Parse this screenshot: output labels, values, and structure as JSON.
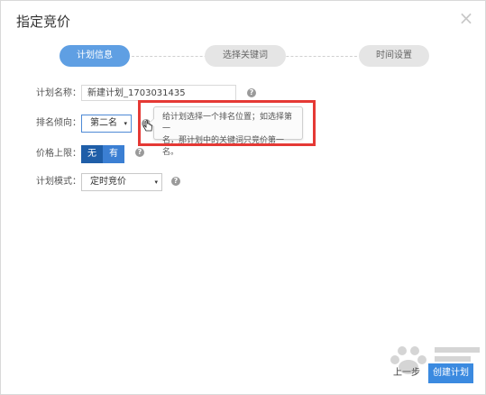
{
  "dialog": {
    "title": "指定竞价",
    "close_icon": "close-icon"
  },
  "steps": [
    {
      "label": "计划信息",
      "active": true
    },
    {
      "label": "选择关键词",
      "active": false
    },
    {
      "label": "时间设置",
      "active": false
    }
  ],
  "form": {
    "plan_name": {
      "label": "计划名称：",
      "value": "新建计划_1703031435"
    },
    "rank_preference": {
      "label": "排名倾向：",
      "value": "第二名"
    },
    "price_cap": {
      "label": "价格上限：",
      "options": [
        "无",
        "有"
      ],
      "selected": "无"
    },
    "plan_mode": {
      "label": "计划模式：",
      "value": "定时竞价"
    },
    "help_glyph": "?"
  },
  "tooltip": {
    "line1": "给计划选择一个排名位置；如选择第一",
    "line2": "名，那计划中的关键词只竞价第一名。"
  },
  "footer": {
    "prev_label": "上一步",
    "create_label": "创建计划"
  },
  "colors": {
    "primary": "#3b8ae0",
    "step_active": "#5f9fe3",
    "highlight": "#e53935"
  }
}
